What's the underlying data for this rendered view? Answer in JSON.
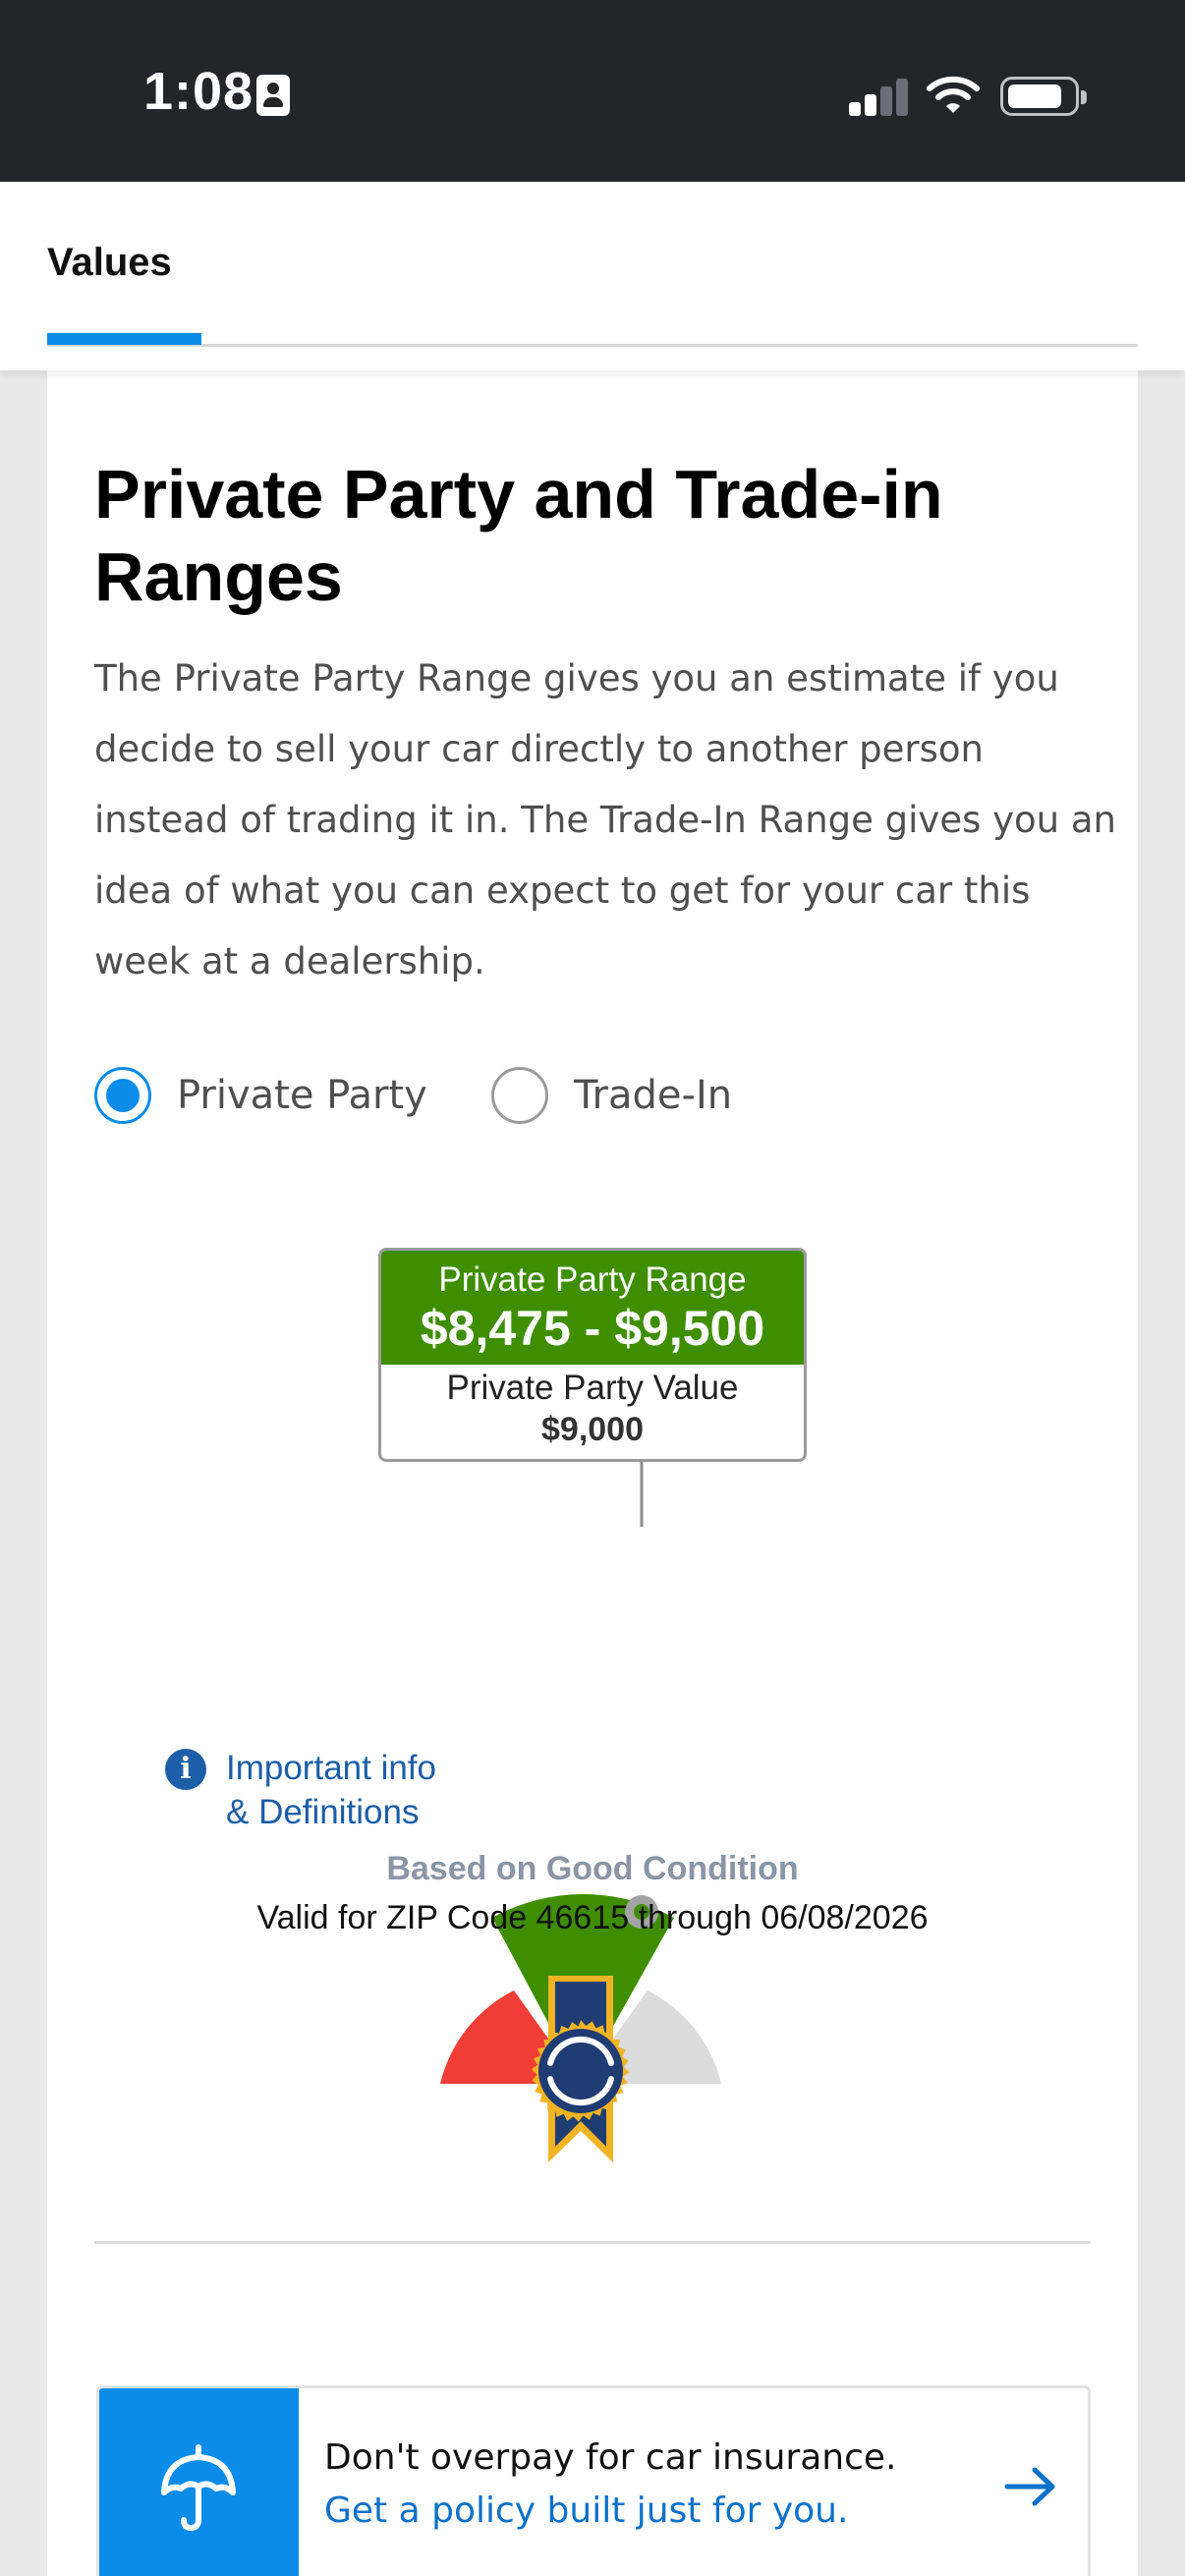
{
  "status_bar": {
    "time": "1:08",
    "icons": [
      "contact-card-icon",
      "cellular-signal-icon",
      "wifi-icon",
      "battery-icon"
    ]
  },
  "header": {
    "active_tab": "Values"
  },
  "section": {
    "title": "Private Party and Trade-in Ranges",
    "description": "The Private Party Range gives you an estimate if you decide to sell your car directly to another person instead of trading it in. The Trade-In Range gives you an idea of what you can expect to get for your car this week at a dealership."
  },
  "options": {
    "selected": "Private Party",
    "private_party_label": "Private Party",
    "trade_in_label": "Trade-In"
  },
  "valuation": {
    "range_label": "Private Party Range",
    "range_value": "$8,475 - $9,500",
    "value_label": "Private Party Value",
    "value_amount": "$9,000",
    "condition": "Based on Good Condition",
    "valid_for": "Valid for ZIP Code 46615 through 06/08/2026"
  },
  "info_link": {
    "line1": "Important info",
    "line2": "& Definitions"
  },
  "insurance_banner": {
    "line1": "Don't overpay for car insurance.",
    "line2": "Get a policy built just for you."
  },
  "colors": {
    "accent_blue": "#0b8ce9",
    "range_green": "#3e8e00",
    "gauge_red": "#f03d36",
    "gauge_gray": "#dcdcdc",
    "badge_navy": "#1f3d73",
    "badge_gold": "#f0b323",
    "link_blue": "#1c5ea8"
  }
}
